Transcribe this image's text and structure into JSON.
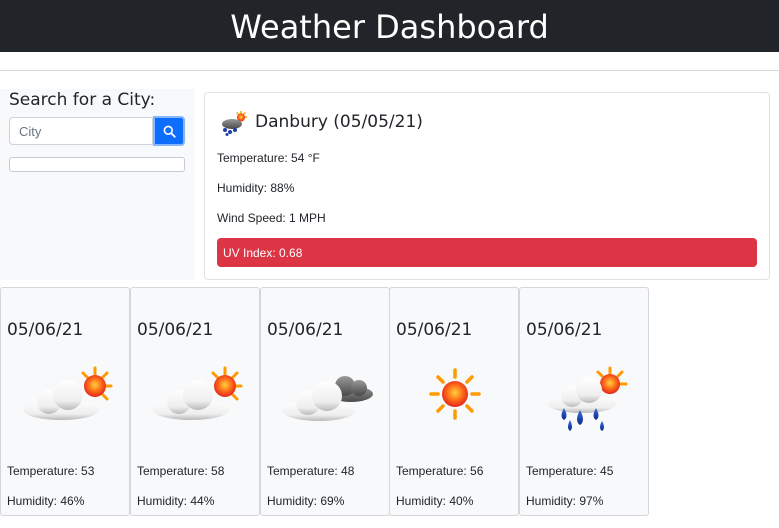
{
  "header": {
    "title": "Weather Dashboard"
  },
  "search": {
    "heading": "Search for a City:",
    "placeholder": "City",
    "button_icon": "search-icon"
  },
  "current": {
    "title": "Danbury (05/05/21)",
    "icon": "sun-cloud-rain-icon",
    "temperature": "Temperature: 54 °F",
    "humidity": "Humidity: 88%",
    "wind": "Wind Speed: 1 MPH",
    "uv": "UV Index: 0.68",
    "uv_color": "#dc3545"
  },
  "forecast": [
    {
      "date": "05/06/21",
      "icon": "partly-sunny-icon",
      "temp": "Temperature: 53",
      "humidity": "Humidity: 46%"
    },
    {
      "date": "05/06/21",
      "icon": "partly-sunny-icon",
      "temp": "Temperature: 58",
      "humidity": "Humidity: 44%"
    },
    {
      "date": "05/06/21",
      "icon": "cloudy-icon",
      "temp": "Temperature: 48",
      "humidity": "Humidity: 69%"
    },
    {
      "date": "05/06/21",
      "icon": "sunny-icon",
      "temp": "Temperature: 56",
      "humidity": "Humidity: 40%"
    },
    {
      "date": "05/06/21",
      "icon": "rain-sun-icon",
      "temp": "Temperature: 45",
      "humidity": "Humidity: 97%"
    }
  ],
  "colors": {
    "header_bg": "#212529",
    "primary": "#0d6efd",
    "danger": "#dc3545",
    "panel": "#f8f9fa"
  }
}
